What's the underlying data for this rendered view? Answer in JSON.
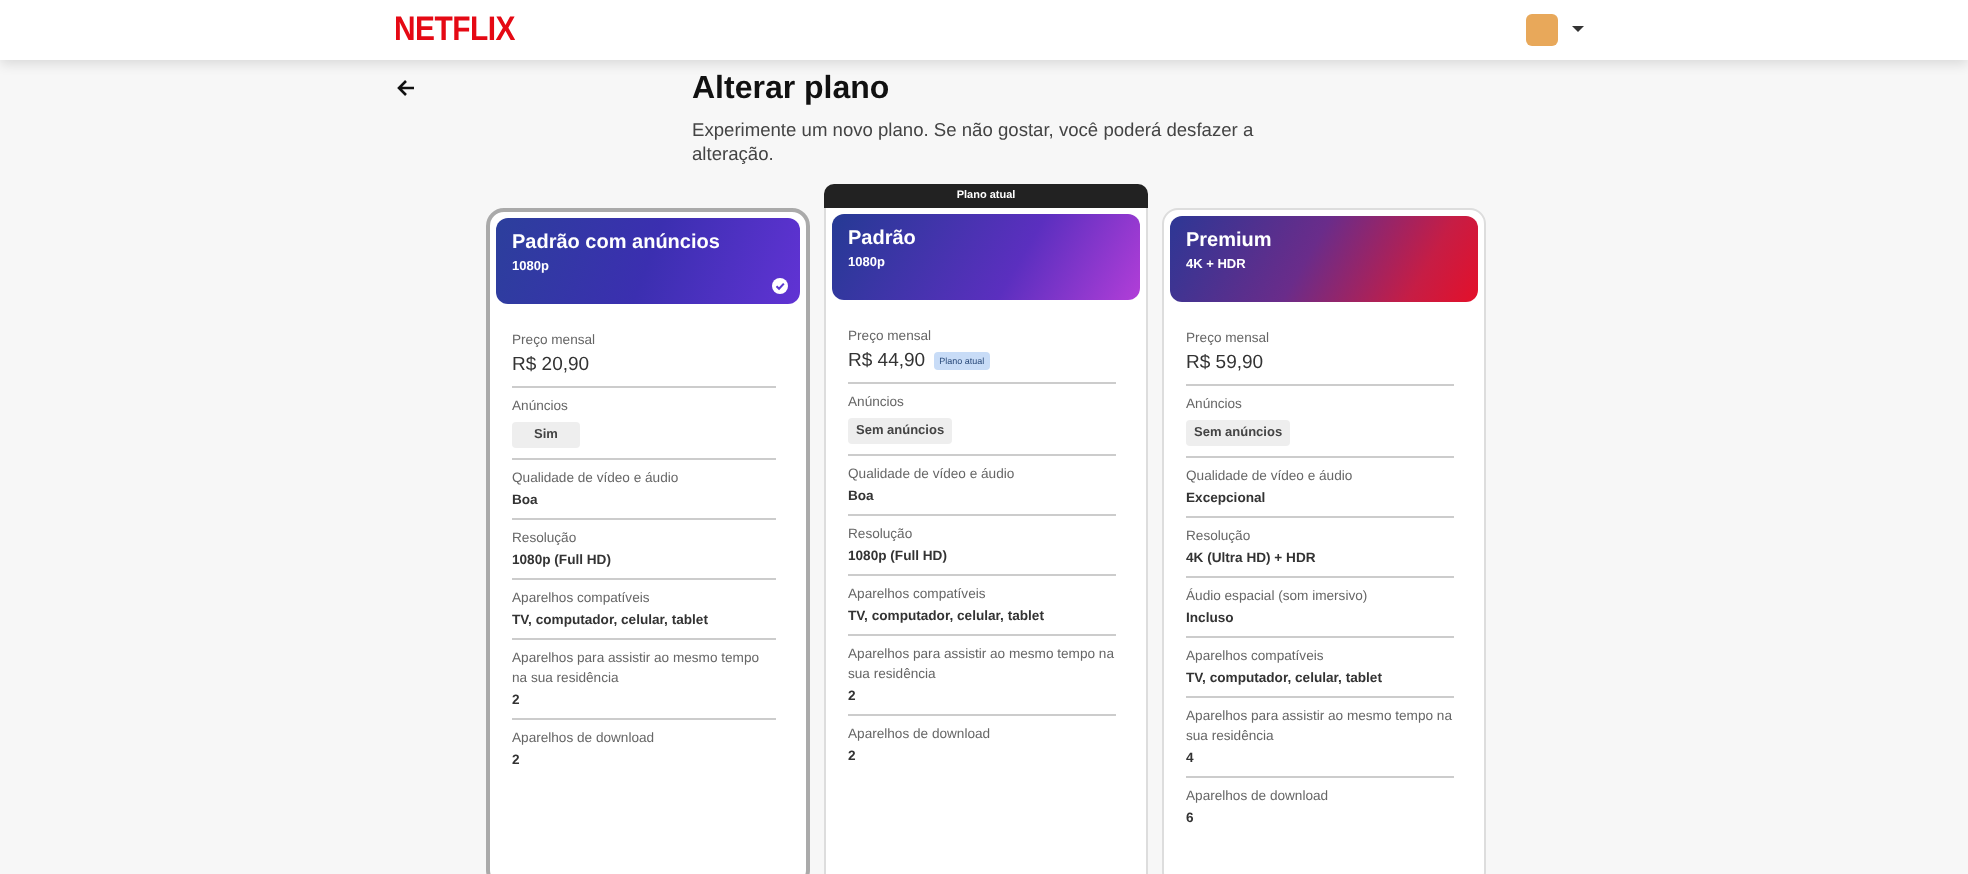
{
  "header": {
    "logo": "NETFLIX"
  },
  "page": {
    "title": "Alterar plano",
    "subtitle": "Experimente um novo plano. Se não gostar, você poderá desfazer a alteração."
  },
  "plans": [
    {
      "name": "Padrão com anúncios",
      "resolution": "1080p",
      "kind": "ads",
      "selected": true,
      "rows": [
        {
          "kind": "price",
          "label": "Preço mensal",
          "value": "R$ 20,90"
        },
        {
          "kind": "chip",
          "label": "Anúncios",
          "value": "Sim"
        },
        {
          "kind": "text",
          "label": "Qualidade de vídeo e áudio",
          "value": "Boa"
        },
        {
          "kind": "text",
          "label": "Resolução",
          "value": "1080p (Full HD)"
        },
        {
          "kind": "text",
          "label": "Aparelhos compatíveis",
          "value": "TV, computador, celular, tablet"
        },
        {
          "kind": "text",
          "label": "Aparelhos para assistir ao mesmo tempo na sua residência",
          "value": "2"
        },
        {
          "kind": "text",
          "label": "Aparelhos de download",
          "value": "2"
        }
      ]
    },
    {
      "name": "Padrão",
      "resolution": "1080p",
      "kind": "standard",
      "selected": false,
      "banner": "Plano atual",
      "rows": [
        {
          "kind": "price",
          "label": "Preço mensal",
          "value": "R$ 44,90",
          "badge": "Plano atual"
        },
        {
          "kind": "chip",
          "label": "Anúncios",
          "value": "Sem anúncios"
        },
        {
          "kind": "text",
          "label": "Qualidade de vídeo e áudio",
          "value": "Boa"
        },
        {
          "kind": "text",
          "label": "Resolução",
          "value": "1080p (Full HD)"
        },
        {
          "kind": "text",
          "label": "Aparelhos compatíveis",
          "value": "TV, computador, celular, tablet"
        },
        {
          "kind": "text",
          "label": "Aparelhos para assistir ao mesmo tempo na sua residência",
          "value": "2"
        },
        {
          "kind": "text",
          "label": "Aparelhos de download",
          "value": "2"
        }
      ]
    },
    {
      "name": "Premium",
      "resolution": "4K + HDR",
      "kind": "premium",
      "selected": false,
      "rows": [
        {
          "kind": "price",
          "label": "Preço mensal",
          "value": "R$ 59,90"
        },
        {
          "kind": "chip",
          "label": "Anúncios",
          "value": "Sem anúncios"
        },
        {
          "kind": "text",
          "label": "Qualidade de vídeo e áudio",
          "value": "Excepcional"
        },
        {
          "kind": "text",
          "label": "Resolução",
          "value": "4K (Ultra HD) + HDR"
        },
        {
          "kind": "text",
          "label": "Áudio espacial (som imersivo)",
          "value": "Incluso"
        },
        {
          "kind": "text",
          "label": "Aparelhos compatíveis",
          "value": "TV, computador, celular, tablet"
        },
        {
          "kind": "text",
          "label": "Aparelhos para assistir ao mesmo tempo na sua residência",
          "value": "4"
        },
        {
          "kind": "text",
          "label": "Aparelhos de download",
          "value": "6"
        }
      ]
    }
  ]
}
